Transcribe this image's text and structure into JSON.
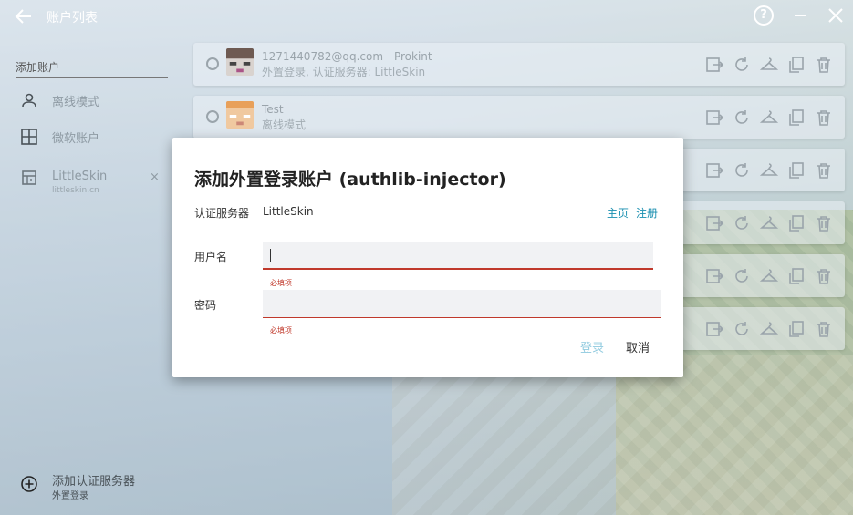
{
  "window": {
    "title": "账户列表",
    "help_label": "?",
    "icons": {
      "back": "arrow-left-icon",
      "help": "help-circle-icon",
      "minimize": "minimize-icon",
      "close": "close-icon"
    }
  },
  "sidebar": {
    "header": "添加账户",
    "items": [
      {
        "label": "离线模式",
        "icon": "person-icon"
      },
      {
        "label": "微软账户",
        "icon": "windows-icon"
      },
      {
        "label": "LittleSkin",
        "sub": "littleskin.cn",
        "icon": "server-icon",
        "remove": "×"
      }
    ],
    "add_server": {
      "label": "添加认证服务器",
      "sub": "外置登录",
      "icon": "plus-circle-icon"
    }
  },
  "accounts": [
    {
      "name": "1271440782@qq.com - Prokint",
      "desc": "外置登录, 认证服务器: LittleSkin"
    },
    {
      "name": "Test",
      "desc": "离线模式"
    }
  ],
  "dialog": {
    "title": "添加外置登录账户 (authlib-injector)",
    "server_label": "认证服务器",
    "server_value": "LittleSkin",
    "link_home": "主页",
    "link_register": "注册",
    "username_label": "用户名",
    "username_value": "",
    "password_label": "密码",
    "password_value": "",
    "required_error": "必填项",
    "login_label": "登录",
    "cancel_label": "取消"
  },
  "colors": {
    "accent": "#1a8fb0",
    "error": "#c0392b",
    "login_disabled": "#8ec9de"
  }
}
